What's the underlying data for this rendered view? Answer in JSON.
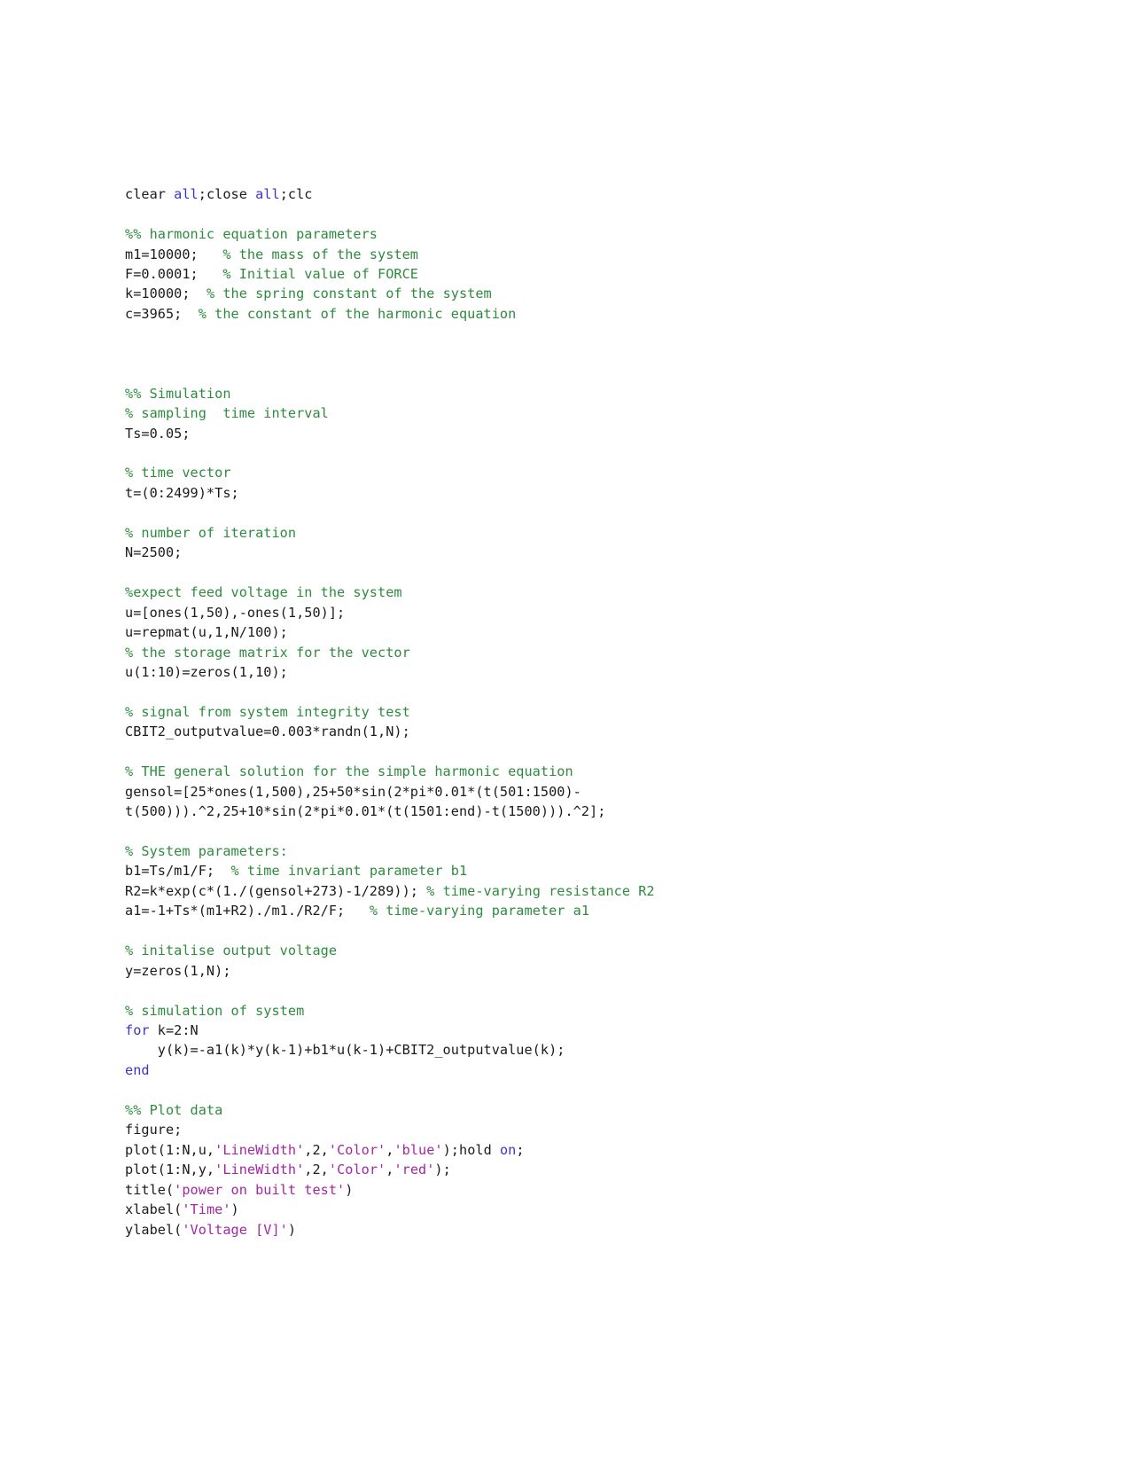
{
  "document": {
    "type": "matlab-script-listing",
    "background_color": "#ffffff",
    "colors": {
      "code": "#1b1b1b",
      "comment": "#2e8b3d",
      "string": "#a327a3",
      "keyword": "#3b35c7"
    },
    "lines": [
      {
        "id": 1,
        "segments": [
          {
            "t": "clear ",
            "c": "code"
          },
          {
            "t": "all",
            "c": "keyword"
          },
          {
            "t": ";close ",
            "c": "code"
          },
          {
            "t": "all",
            "c": "keyword"
          },
          {
            "t": ";clc",
            "c": "code"
          }
        ]
      },
      {
        "id": 2,
        "segments": []
      },
      {
        "id": 3,
        "segments": [
          {
            "t": "%% harmonic equation parameters",
            "c": "comment"
          }
        ]
      },
      {
        "id": 4,
        "segments": [
          {
            "t": "m1=10000;",
            "c": "code"
          },
          {
            "t": "   % the mass of the system",
            "c": "comment"
          }
        ]
      },
      {
        "id": 5,
        "segments": [
          {
            "t": "F=0.0001;",
            "c": "code"
          },
          {
            "t": "   % Initial value of FORCE",
            "c": "comment"
          }
        ]
      },
      {
        "id": 6,
        "segments": [
          {
            "t": "k=10000;",
            "c": "code"
          },
          {
            "t": "  % the spring constant of the system",
            "c": "comment"
          }
        ]
      },
      {
        "id": 7,
        "segments": [
          {
            "t": "c=3965;",
            "c": "code"
          },
          {
            "t": "  % the constant of the harmonic equation",
            "c": "comment"
          }
        ]
      },
      {
        "id": 8,
        "segments": []
      },
      {
        "id": 9,
        "segments": []
      },
      {
        "id": 10,
        "segments": []
      },
      {
        "id": 11,
        "segments": [
          {
            "t": "%% Simulation",
            "c": "comment"
          }
        ]
      },
      {
        "id": 12,
        "segments": [
          {
            "t": "% sampling  time interval",
            "c": "comment"
          }
        ]
      },
      {
        "id": 13,
        "segments": [
          {
            "t": "Ts=0.05;",
            "c": "code"
          }
        ]
      },
      {
        "id": 14,
        "segments": []
      },
      {
        "id": 15,
        "segments": [
          {
            "t": "% time vector",
            "c": "comment"
          }
        ]
      },
      {
        "id": 16,
        "segments": [
          {
            "t": "t=(0:2499)*Ts;",
            "c": "code"
          }
        ]
      },
      {
        "id": 17,
        "segments": []
      },
      {
        "id": 18,
        "segments": [
          {
            "t": "% number of iteration",
            "c": "comment"
          }
        ]
      },
      {
        "id": 19,
        "segments": [
          {
            "t": "N=2500;",
            "c": "code"
          }
        ]
      },
      {
        "id": 20,
        "segments": []
      },
      {
        "id": 21,
        "segments": [
          {
            "t": "%expect feed voltage in the system",
            "c": "comment"
          }
        ]
      },
      {
        "id": 22,
        "segments": [
          {
            "t": "u=[ones(1,50),-ones(1,50)];",
            "c": "code"
          }
        ]
      },
      {
        "id": 23,
        "segments": [
          {
            "t": "u=repmat(u,1,N/100);",
            "c": "code"
          }
        ]
      },
      {
        "id": 24,
        "segments": [
          {
            "t": "% the storage matrix for the vector",
            "c": "comment"
          }
        ]
      },
      {
        "id": 25,
        "segments": [
          {
            "t": "u(1:10)=zeros(1,10);",
            "c": "code"
          }
        ]
      },
      {
        "id": 26,
        "segments": []
      },
      {
        "id": 27,
        "segments": [
          {
            "t": "% signal from system integrity test",
            "c": "comment"
          }
        ]
      },
      {
        "id": 28,
        "segments": [
          {
            "t": "CBIT2_outputvalue=0.003*randn(1,N);",
            "c": "code"
          }
        ]
      },
      {
        "id": 29,
        "segments": []
      },
      {
        "id": 30,
        "segments": [
          {
            "t": "% THE general solution for the simple harmonic equation",
            "c": "comment"
          }
        ]
      },
      {
        "id": 31,
        "segments": [
          {
            "t": "gensol=[25*ones(1,500),25+50*sin(2*pi*0.01*(t(501:1500)-",
            "c": "code"
          }
        ]
      },
      {
        "id": 32,
        "segments": [
          {
            "t": "t(500))).^2,25+10*sin(2*pi*0.01*(t(1501:end)-t(1500))).^2];",
            "c": "code"
          }
        ]
      },
      {
        "id": 33,
        "segments": []
      },
      {
        "id": 34,
        "segments": [
          {
            "t": "% System parameters:",
            "c": "comment"
          }
        ]
      },
      {
        "id": 35,
        "segments": [
          {
            "t": "b1=Ts/m1/F;",
            "c": "code"
          },
          {
            "t": "  % time invariant parameter b1",
            "c": "comment"
          }
        ]
      },
      {
        "id": 36,
        "segments": [
          {
            "t": "R2=k*exp(c*(1./(gensol+273)-1/289));",
            "c": "code"
          },
          {
            "t": " % time-varying resistance R2",
            "c": "comment"
          }
        ]
      },
      {
        "id": 37,
        "segments": [
          {
            "t": "a1=-1+Ts*(m1+R2)./m1./R2/F;",
            "c": "code"
          },
          {
            "t": "   % time-varying parameter a1",
            "c": "comment"
          }
        ]
      },
      {
        "id": 38,
        "segments": []
      },
      {
        "id": 39,
        "segments": [
          {
            "t": "% initalise output voltage",
            "c": "comment"
          }
        ]
      },
      {
        "id": 40,
        "segments": [
          {
            "t": "y=zeros(1,N);",
            "c": "code"
          }
        ]
      },
      {
        "id": 41,
        "segments": []
      },
      {
        "id": 42,
        "segments": [
          {
            "t": "% simulation of system",
            "c": "comment"
          }
        ]
      },
      {
        "id": 43,
        "segments": [
          {
            "t": "for",
            "c": "keyword"
          },
          {
            "t": " k=2:N",
            "c": "code"
          }
        ]
      },
      {
        "id": 44,
        "segments": [
          {
            "t": "    y(k)=-a1(k)*y(k-1)+b1*u(k-1)+CBIT2_outputvalue(k);",
            "c": "code"
          }
        ]
      },
      {
        "id": 45,
        "segments": [
          {
            "t": "end",
            "c": "keyword"
          }
        ]
      },
      {
        "id": 46,
        "segments": []
      },
      {
        "id": 47,
        "segments": [
          {
            "t": "%% Plot data",
            "c": "comment"
          }
        ]
      },
      {
        "id": 48,
        "segments": [
          {
            "t": "figure;",
            "c": "code"
          }
        ]
      },
      {
        "id": 49,
        "segments": [
          {
            "t": "plot(1:N,u,",
            "c": "code"
          },
          {
            "t": "'LineWidth'",
            "c": "string"
          },
          {
            "t": ",2,",
            "c": "code"
          },
          {
            "t": "'Color'",
            "c": "string"
          },
          {
            "t": ",",
            "c": "code"
          },
          {
            "t": "'blue'",
            "c": "string"
          },
          {
            "t": ");hold ",
            "c": "code"
          },
          {
            "t": "on",
            "c": "keyword"
          },
          {
            "t": ";",
            "c": "code"
          }
        ]
      },
      {
        "id": 50,
        "segments": [
          {
            "t": "plot(1:N,y,",
            "c": "code"
          },
          {
            "t": "'LineWidth'",
            "c": "string"
          },
          {
            "t": ",2,",
            "c": "code"
          },
          {
            "t": "'Color'",
            "c": "string"
          },
          {
            "t": ",",
            "c": "code"
          },
          {
            "t": "'red'",
            "c": "string"
          },
          {
            "t": ");",
            "c": "code"
          }
        ]
      },
      {
        "id": 51,
        "segments": [
          {
            "t": "title(",
            "c": "code"
          },
          {
            "t": "'power on built test'",
            "c": "string"
          },
          {
            "t": ")",
            "c": "code"
          }
        ]
      },
      {
        "id": 52,
        "segments": [
          {
            "t": "xlabel(",
            "c": "code"
          },
          {
            "t": "'Time'",
            "c": "string"
          },
          {
            "t": ")",
            "c": "code"
          }
        ]
      },
      {
        "id": 53,
        "segments": [
          {
            "t": "ylabel(",
            "c": "code"
          },
          {
            "t": "'Voltage [V]'",
            "c": "string"
          },
          {
            "t": ")",
            "c": "code"
          }
        ]
      }
    ]
  }
}
